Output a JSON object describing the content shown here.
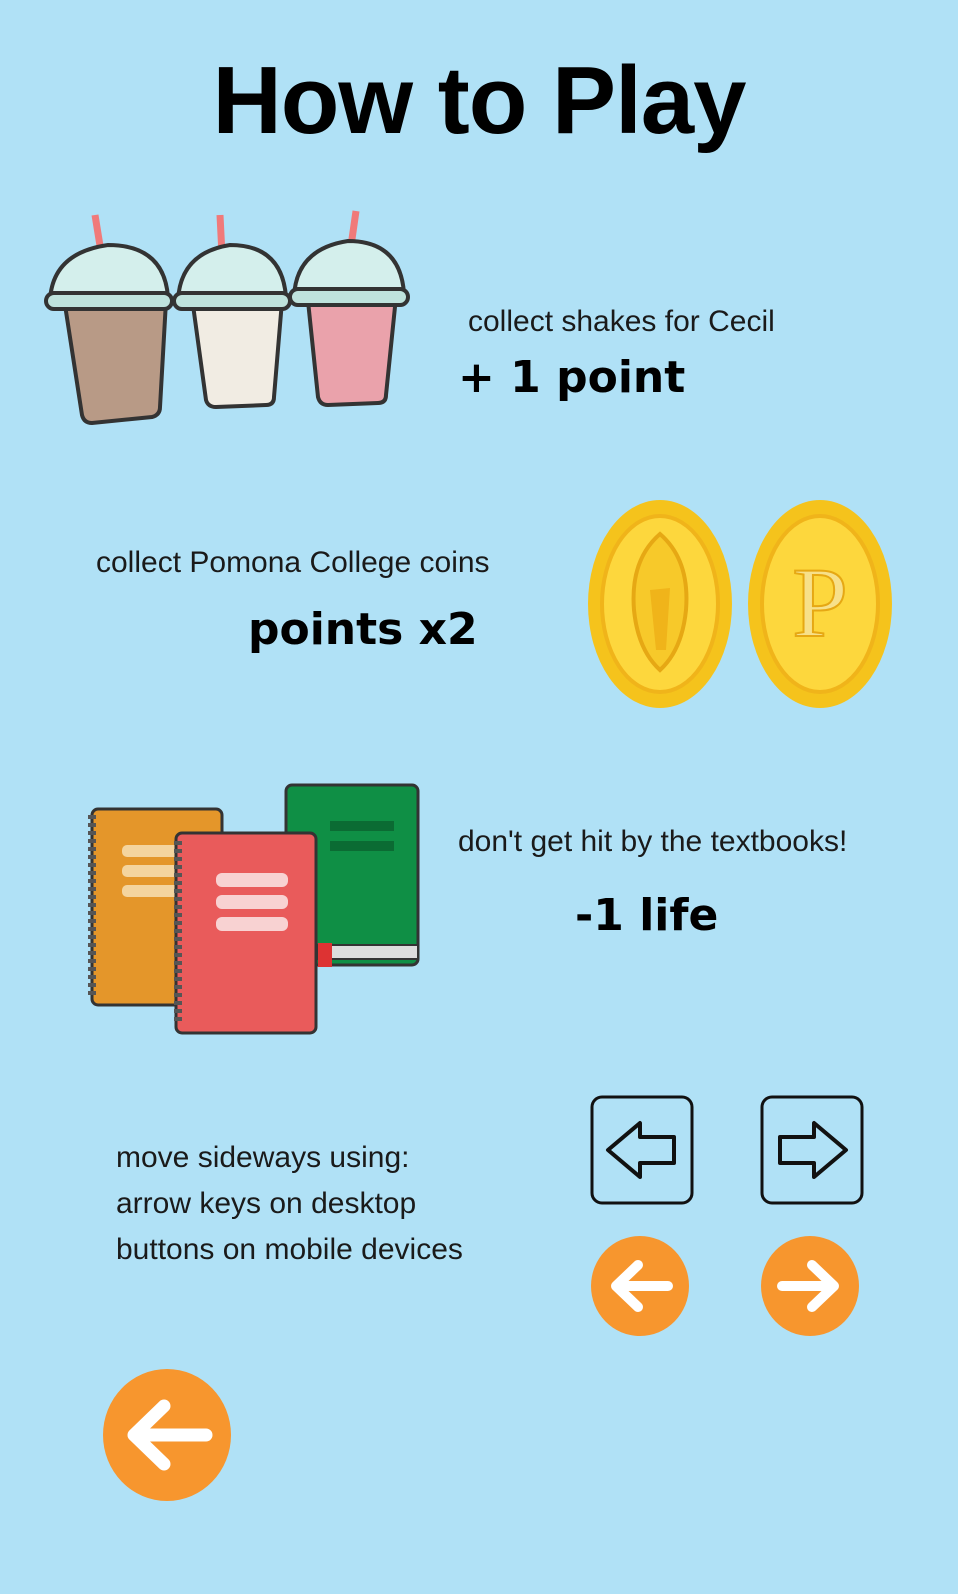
{
  "title": "How to Play",
  "sections": {
    "shakes": {
      "text": "collect shakes for Cecil",
      "effect": "+ 1 point"
    },
    "coins": {
      "text": "collect Pomona College coins",
      "effect": "points x2",
      "coin_letter": "P"
    },
    "textbooks": {
      "text": "don't get hit by the textbooks!",
      "effect": "-1 life"
    },
    "movement": {
      "lines": [
        "move sideways using:",
        "arrow keys on desktop",
        "buttons on mobile devices"
      ]
    }
  },
  "icons": {
    "keyboard_left": "left-arrow-key-icon",
    "keyboard_right": "right-arrow-key-icon",
    "mobile_left": "left-arrow-button-icon",
    "mobile_right": "right-arrow-button-icon",
    "back": "back-arrow-icon"
  },
  "colors": {
    "background": "#b0e1f6",
    "orange": "#f7962e",
    "gold": "#f5c31c",
    "book_orange": "#e4962a",
    "book_red": "#e95b5b",
    "book_green": "#0f8f45"
  }
}
